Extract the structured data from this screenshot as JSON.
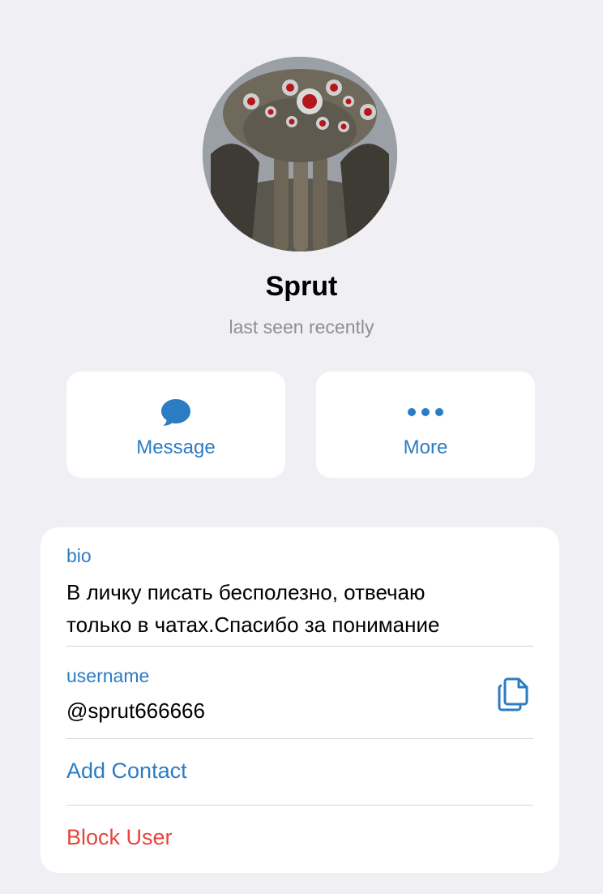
{
  "profile": {
    "name": "Sprut",
    "status": "last seen recently",
    "avatar_icon": "avatar-image"
  },
  "actions": {
    "message_label": "Message",
    "message_icon": "chat-bubble-icon",
    "more_label": "More",
    "more_icon": "ellipsis-icon"
  },
  "info": {
    "bio_label": "bio",
    "bio_lines": [
      "В личку писать бесполезно, отвечаю",
      "только в чатах.Спасибо за понимание"
    ],
    "username_label": "username",
    "username_value": "@sprut666666",
    "copy_icon": "copy-icon",
    "add_contact_label": "Add Contact",
    "block_user_label": "Block User"
  },
  "colors": {
    "background": "#efeff4",
    "accent": "#2c7cc4",
    "destructive": "#e5453c",
    "secondary_text": "#8e8e93"
  }
}
